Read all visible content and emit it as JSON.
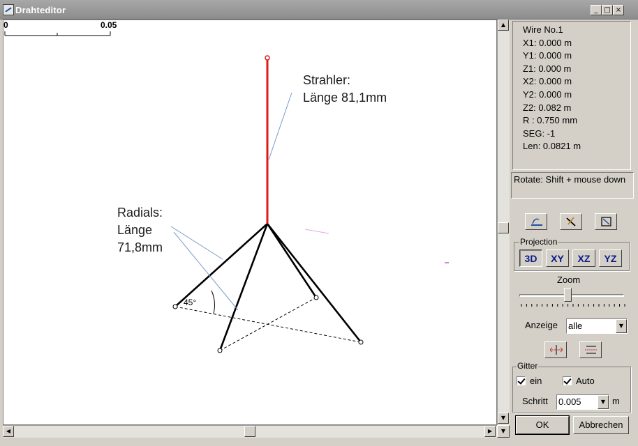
{
  "window": {
    "title": "Drahteditor",
    "minimize": "_",
    "maximize": "□",
    "close": "×"
  },
  "canvas": {
    "ruler": {
      "start_label": "0",
      "end_label": "0.05"
    },
    "annotations": {
      "strahler_line1": "Strahler:",
      "strahler_line2": "Länge 81,1mm",
      "radials_line1": "Radials:",
      "radials_line2": "Länge",
      "radials_line3": "71,8mm",
      "angle": "45°"
    },
    "colors": {
      "radiator": "#e01818",
      "radial": "#000000",
      "leader": "#7a9ac8"
    }
  },
  "info": {
    "wire": "Wire No.1",
    "x1": "X1: 0.000 m",
    "y1": "Y1: 0.000 m",
    "z1": "Z1: 0.000 m",
    "x2": "X2: 0.000 m",
    "y2": "Y2: 0.000 m",
    "z2": "Z2: 0.082 m",
    "r": "R : 0.750 mm",
    "seg": "SEG: -1",
    "len": "Len: 0.0821 m"
  },
  "hint": "Rotate: Shift + mouse down",
  "tools": [
    "wire-draw-icon",
    "wire-edit-icon",
    "wire-select-icon"
  ],
  "projection": {
    "label": "Projection",
    "buttons": [
      "3D",
      "XY",
      "XZ",
      "YZ"
    ],
    "active": "3D"
  },
  "zoom": {
    "label": "Zoom"
  },
  "anzeige": {
    "label": "Anzeige",
    "value": "alle"
  },
  "gitter": {
    "label": "Gitter",
    "ein_label": "ein",
    "auto_label": "Auto",
    "schritt_label": "Schritt",
    "schritt_value": "0.005",
    "unit": "m"
  },
  "buttons": {
    "ok": "OK",
    "cancel": "Abbrechen"
  }
}
